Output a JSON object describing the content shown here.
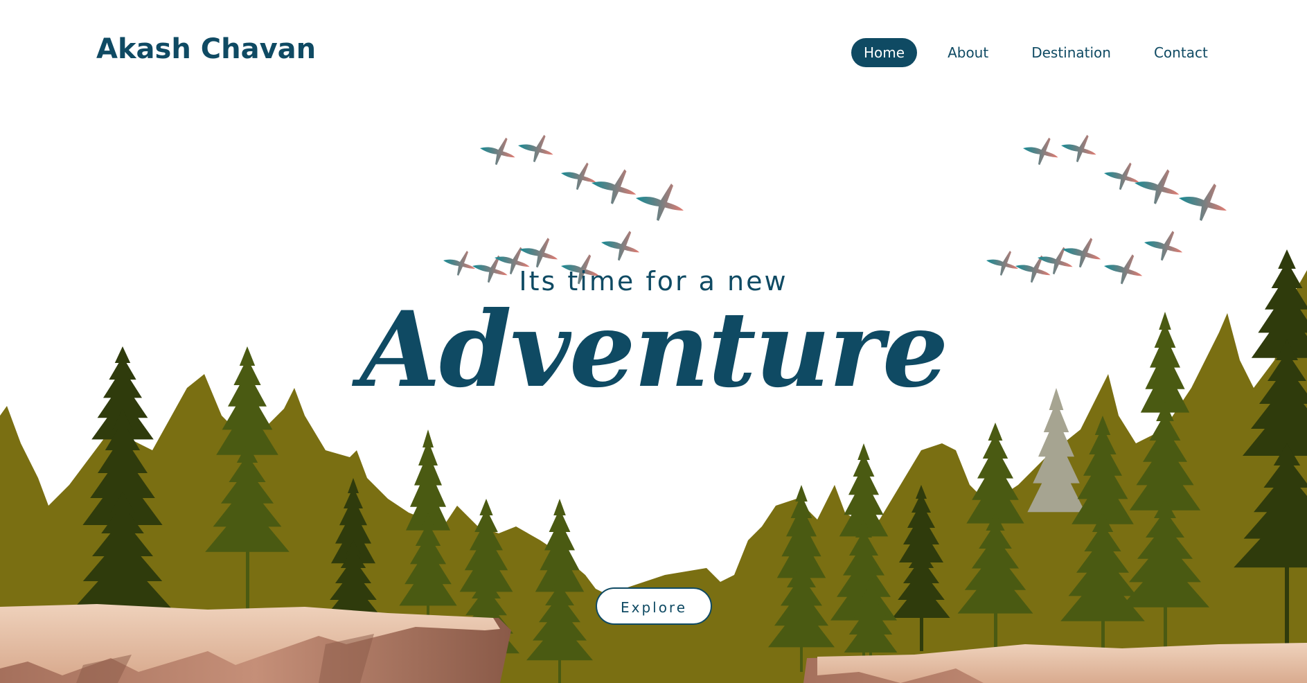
{
  "header": {
    "brand": "Akash Chavan",
    "nav": [
      {
        "label": "Home",
        "active": true
      },
      {
        "label": "About",
        "active": false
      },
      {
        "label": "Destination",
        "active": false
      },
      {
        "label": "Contact",
        "active": false
      }
    ]
  },
  "hero": {
    "tagline": "Its time for a new",
    "headline": "Adventure",
    "cta_label": "Explore"
  },
  "colors": {
    "primary": "#0f4a63",
    "background": "#ffffff",
    "tree_olive": "#7a6f12",
    "tree_dark": "#2f3b0c",
    "tree_green": "#4a5a12",
    "rock_light": "#e7c0a5",
    "rock_dark": "#9c6f5d",
    "bird_teal": "#168a94",
    "bird_coral": "#e47c72"
  },
  "icons": {
    "birds": "bird-flock-icon",
    "trees": "pine-tree-icon"
  }
}
